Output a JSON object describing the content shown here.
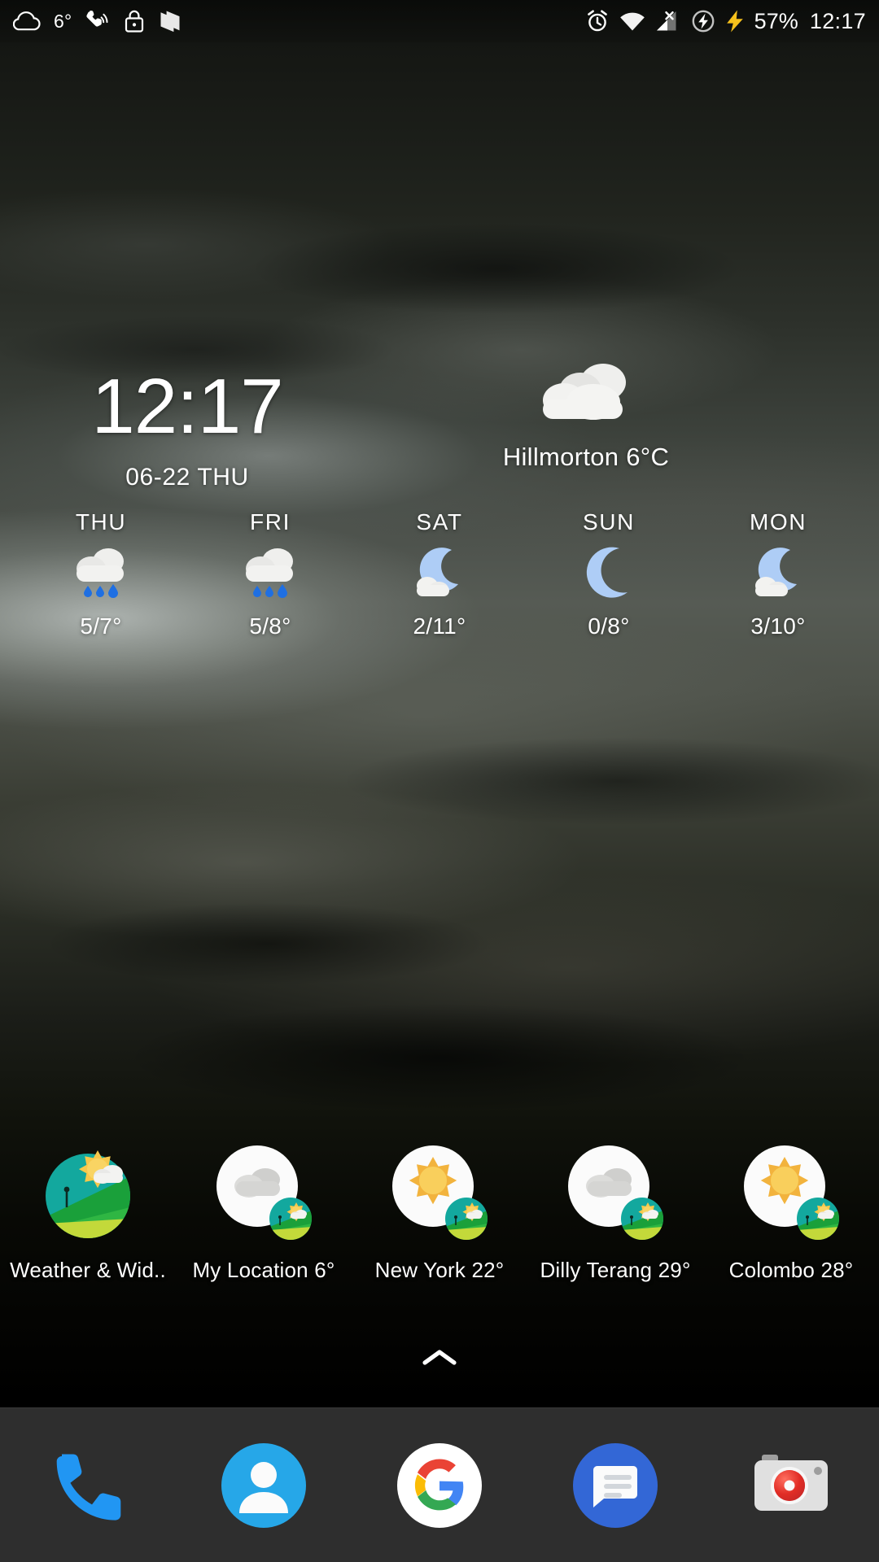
{
  "status_bar": {
    "left_icons": [
      {
        "name": "cloud-icon",
        "glyph": "cloud"
      },
      {
        "name": "status-temperature",
        "label": "6°"
      },
      {
        "name": "phone-ring-icon",
        "glyph": "phone-ring"
      },
      {
        "name": "lock-icon",
        "glyph": "lock"
      },
      {
        "name": "nougat-icon",
        "glyph": "nougat-n"
      }
    ],
    "temperature": "6°",
    "right_icons": [
      {
        "name": "alarm-icon",
        "glyph": "alarm"
      },
      {
        "name": "wifi-icon",
        "glyph": "wifi"
      },
      {
        "name": "cellular-signal-off-icon",
        "glyph": "signal-x"
      },
      {
        "name": "data-saver-icon",
        "glyph": "data-saver"
      },
      {
        "name": "charging-bolt-icon",
        "glyph": "bolt"
      }
    ],
    "battery_percent": "57%",
    "clock": "12:17"
  },
  "widget": {
    "time": "12:17",
    "date": "06-22 THU",
    "location": "Hillmorton 6°C",
    "current_condition_icon": "cloudy",
    "forecast": [
      {
        "day": "THU",
        "icon": "rain",
        "temps": "5/7°"
      },
      {
        "day": "FRI",
        "icon": "rain",
        "temps": "5/8°"
      },
      {
        "day": "SAT",
        "icon": "moon-cloudy",
        "temps": "2/11°"
      },
      {
        "day": "SUN",
        "icon": "moon",
        "temps": "0/8°"
      },
      {
        "day": "MON",
        "icon": "moon-cloudy",
        "temps": "3/10°"
      }
    ]
  },
  "apps": [
    {
      "label": "Weather & Wid..",
      "icon": "weather-widgets-app",
      "badge": "none"
    },
    {
      "label": "My Location 6°",
      "icon": "weather-shortcut-cloudy",
      "badge": "cloudy"
    },
    {
      "label": "New York 22°",
      "icon": "weather-shortcut-sunny",
      "badge": "sunny"
    },
    {
      "label": "Dilly Terang 29°",
      "icon": "weather-shortcut-cloudy",
      "badge": "cloudy"
    },
    {
      "label": "Colombo 28°",
      "icon": "weather-shortcut-sunny",
      "badge": "sunny"
    }
  ],
  "app_drawer_handle": {
    "name": "app-drawer-chevron-up",
    "glyph": "chevron-up"
  },
  "dock": [
    {
      "name": "phone-app",
      "label": "Phone",
      "icon": "phone"
    },
    {
      "name": "contacts-app",
      "label": "Contacts",
      "icon": "contacts"
    },
    {
      "name": "google-app",
      "label": "Google",
      "icon": "google-g"
    },
    {
      "name": "messages-app",
      "label": "Messages",
      "icon": "messages"
    },
    {
      "name": "camera-app",
      "label": "Camera",
      "icon": "camera"
    }
  ],
  "colors": {
    "accent_blue": "#1e9de5",
    "rain_drop": "#1e6fe0",
    "moon": "#aecbf5",
    "cloud_white": "#f0f0ee",
    "dock_bg": "#303030",
    "charging_yellow": "#f5c518",
    "sun_yellow": "#f7c34a"
  }
}
